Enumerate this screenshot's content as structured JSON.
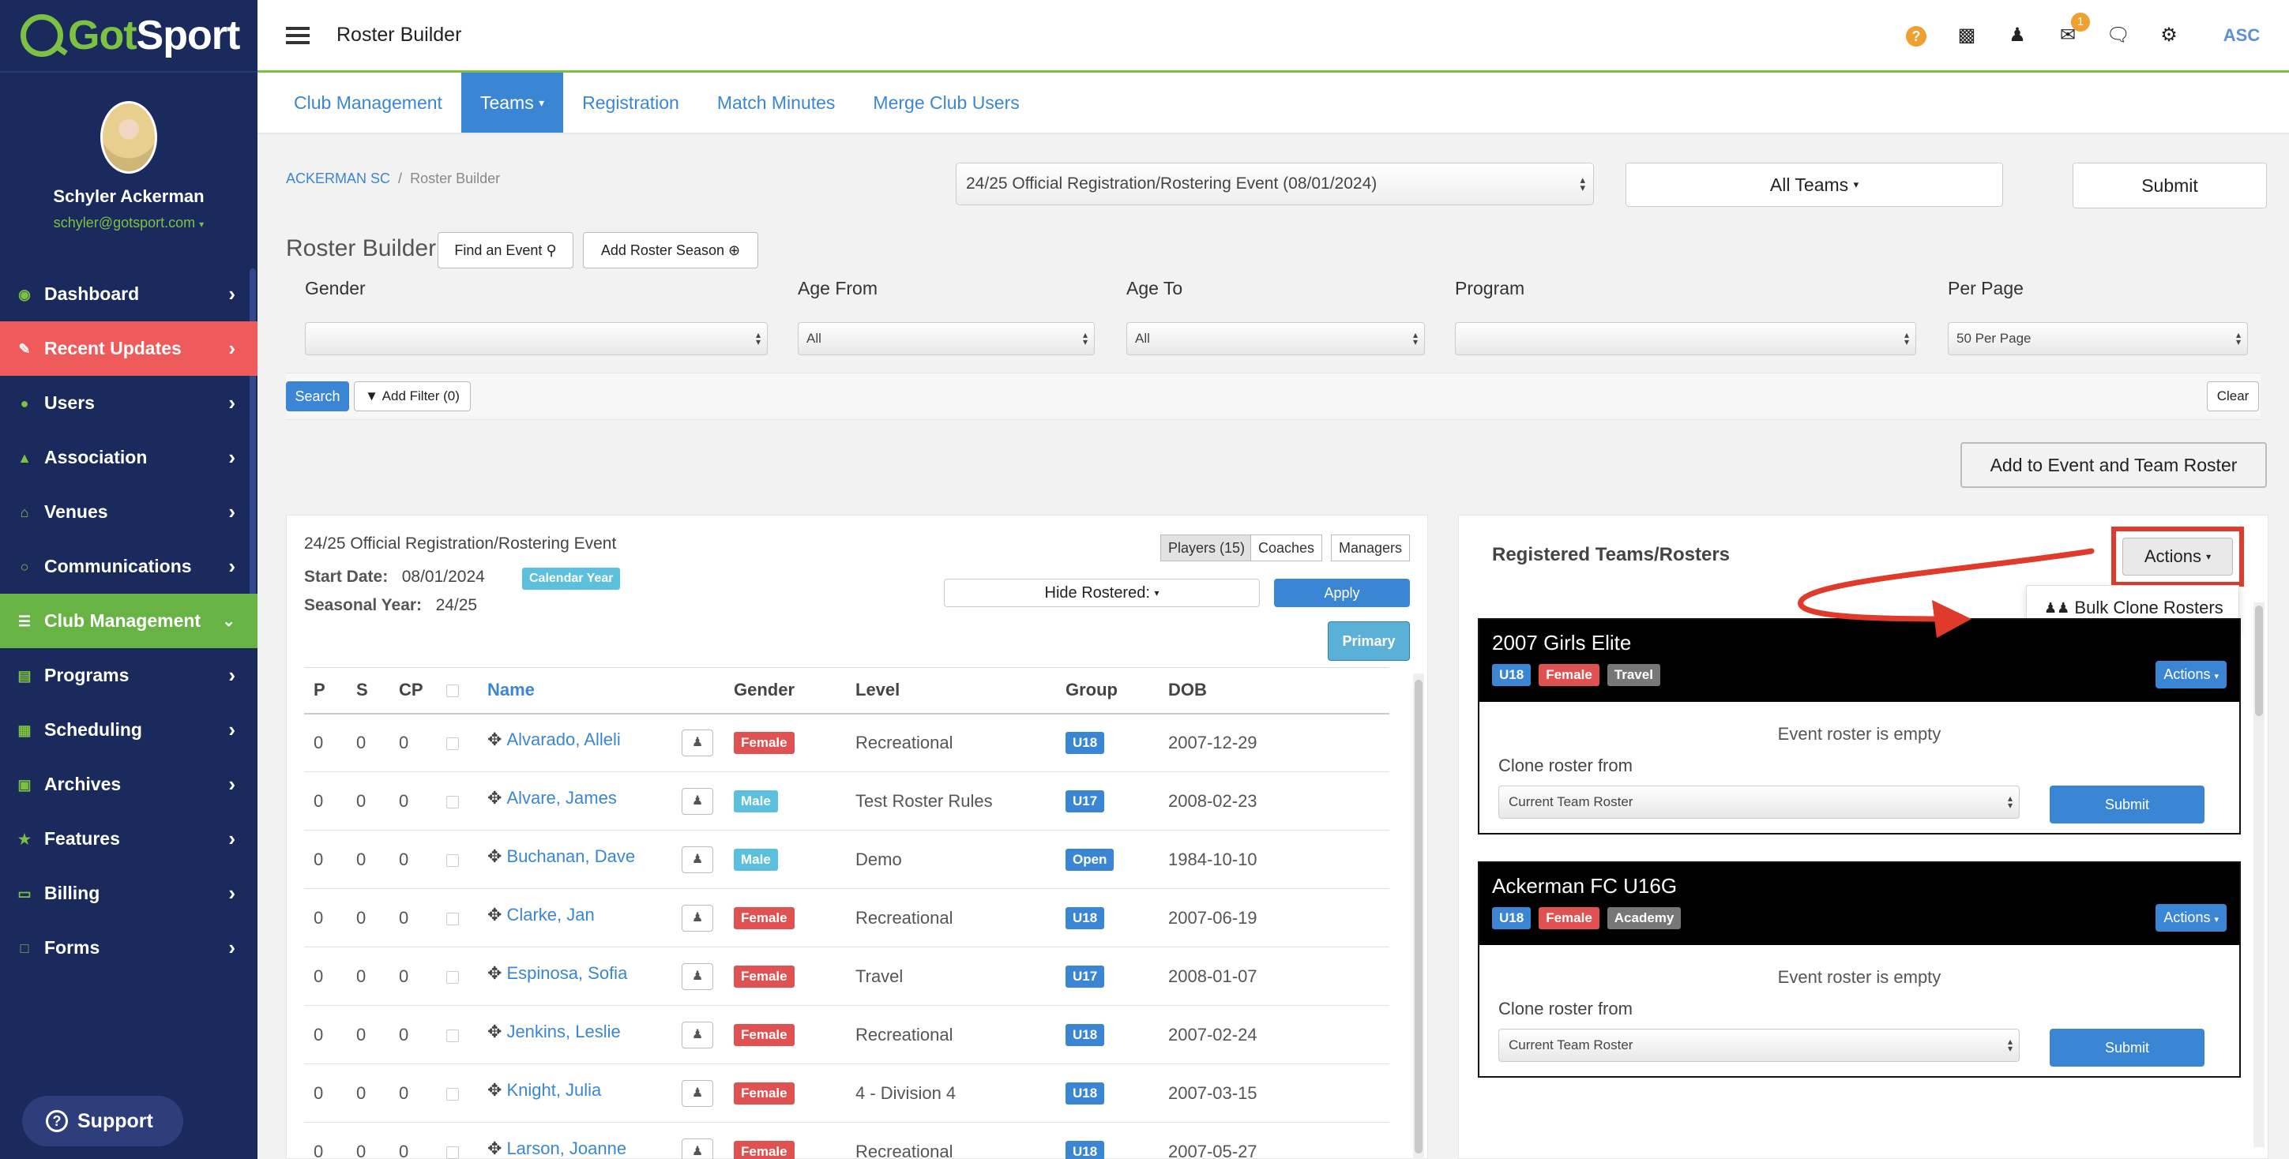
{
  "brand": {
    "logo_text_got": "Got",
    "logo_text_sport": "Sport"
  },
  "profile": {
    "name": "Schyler Ackerman",
    "email": "schyler@gotsport.com"
  },
  "sidebar": {
    "items": [
      {
        "label": "Dashboard",
        "icon": "dashboard-icon"
      },
      {
        "label": "Recent Updates",
        "icon": "updates-icon"
      },
      {
        "label": "Users",
        "icon": "users-icon"
      },
      {
        "label": "Association",
        "icon": "sitemap-icon"
      },
      {
        "label": "Venues",
        "icon": "home-icon"
      },
      {
        "label": "Communications",
        "icon": "chat-icon"
      },
      {
        "label": "Club Management",
        "icon": "list-icon"
      },
      {
        "label": "Programs",
        "icon": "file-icon"
      },
      {
        "label": "Scheduling",
        "icon": "calendar-icon"
      },
      {
        "label": "Archives",
        "icon": "archive-icon"
      },
      {
        "label": "Features",
        "icon": "star-icon"
      },
      {
        "label": "Billing",
        "icon": "credit-card-icon"
      },
      {
        "label": "Forms",
        "icon": "document-icon"
      }
    ],
    "support_label": "Support"
  },
  "topbar": {
    "title": "Roster Builder",
    "notification_count": "1",
    "user_initials": "ASC"
  },
  "tabs": [
    "Club Management",
    "Teams",
    "Registration",
    "Match Minutes",
    "Merge Club Users"
  ],
  "breadcrumb": {
    "club": "ACKERMAN SC",
    "sep": "/",
    "current": "Roster Builder"
  },
  "event_select": "24/25 Official Registration/Rostering Event (08/01/2024)",
  "teams_select": "All Teams",
  "submit_label": "Submit",
  "roster_builder": {
    "title": "Roster Builder",
    "find_event": "Find an Event",
    "add_season": "Add Roster Season"
  },
  "filters": {
    "gender_label": "Gender",
    "gender_value": "",
    "age_from_label": "Age From",
    "age_from_value": "All",
    "age_to_label": "Age To",
    "age_to_value": "All",
    "program_label": "Program",
    "program_value": "",
    "per_page_label": "Per Page",
    "per_page_value": "50 Per Page",
    "search": "Search",
    "add_filter": "Add Filter (0)",
    "clear": "Clear"
  },
  "add_event_team": "Add to Event and Team Roster",
  "left_panel": {
    "event_title": "24/25 Official Registration/Rostering Event",
    "start_date_label": "Start Date:",
    "start_date": "08/01/2024",
    "calendar_badge": "Calendar Year",
    "seasonal_label": "Seasonal Year:",
    "seasonal_year": "24/25",
    "players_btn": "Players (15)",
    "coaches_btn": "Coaches",
    "managers_btn": "Managers",
    "hide_rostered": "Hide Rostered:",
    "apply": "Apply",
    "primary": "Primary",
    "columns": [
      "P",
      "S",
      "CP",
      "Name",
      "Gender",
      "Level",
      "Group",
      "DOB"
    ],
    "rows": [
      {
        "p": "0",
        "s": "0",
        "cp": "0",
        "name": "Alvarado, Alleli",
        "gender": "Female",
        "level": "Recreational",
        "group": "U18",
        "dob": "2007-12-29"
      },
      {
        "p": "0",
        "s": "0",
        "cp": "0",
        "name": "Alvare, James",
        "gender": "Male",
        "level": "Test Roster Rules",
        "group": "U17",
        "dob": "2008-02-23"
      },
      {
        "p": "0",
        "s": "0",
        "cp": "0",
        "name": "Buchanan, Dave",
        "gender": "Male",
        "level": "Demo",
        "group": "Open",
        "dob": "1984-10-10"
      },
      {
        "p": "0",
        "s": "0",
        "cp": "0",
        "name": "Clarke, Jan",
        "gender": "Female",
        "level": "Recreational",
        "group": "U18",
        "dob": "2007-06-19"
      },
      {
        "p": "0",
        "s": "0",
        "cp": "0",
        "name": "Espinosa, Sofia",
        "gender": "Female",
        "level": "Travel",
        "group": "U17",
        "dob": "2008-01-07"
      },
      {
        "p": "0",
        "s": "0",
        "cp": "0",
        "name": "Jenkins, Leslie",
        "gender": "Female",
        "level": "Recreational",
        "group": "U18",
        "dob": "2007-02-24"
      },
      {
        "p": "0",
        "s": "0",
        "cp": "0",
        "name": "Knight, Julia",
        "gender": "Female",
        "level": "4 - Division 4",
        "group": "U18",
        "dob": "2007-03-15"
      },
      {
        "p": "0",
        "s": "0",
        "cp": "0",
        "name": "Larson, Joanne",
        "gender": "Female",
        "level": "Recreational",
        "group": "U18",
        "dob": "2007-05-27"
      }
    ]
  },
  "right_panel": {
    "title": "Registered Teams/Rosters",
    "actions": "Actions",
    "dropdown_item": "Bulk Clone Rosters",
    "cards": [
      {
        "name": "2007 Girls Elite",
        "badges": [
          "U18",
          "Female",
          "Travel"
        ],
        "actions": "Actions",
        "empty": "Event roster is empty",
        "clone_label": "Clone roster from",
        "clone_value": "Current Team Roster",
        "submit": "Submit"
      },
      {
        "name": "Ackerman FC U16G",
        "badges": [
          "U18",
          "Female",
          "Academy"
        ],
        "actions": "Actions",
        "empty": "Event roster is empty",
        "clone_label": "Clone roster from",
        "clone_value": "Current Team Roster",
        "submit": "Submit"
      }
    ]
  },
  "colors": {
    "sidebar": "#1b2a5c",
    "accent_green": "#7cc242",
    "link_blue": "#3a86d4",
    "highlight_red": "#e03a2a",
    "recent_updates": "#ef5a5a"
  }
}
